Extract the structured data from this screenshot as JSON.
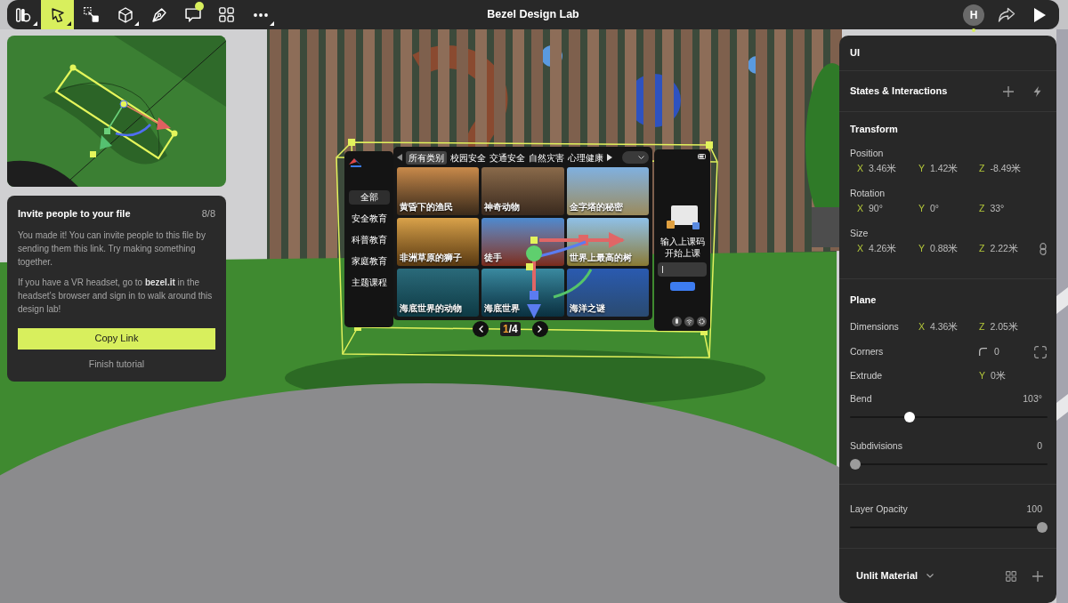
{
  "window": {
    "title": "Bezel Design Lab"
  },
  "toolbar": {
    "tools": [
      {
        "kind": "logo",
        "selected": false,
        "menu": true,
        "badge": false
      },
      {
        "kind": "select",
        "selected": true,
        "menu": true,
        "badge": false
      },
      {
        "kind": "scale",
        "selected": false,
        "menu": false,
        "badge": false
      },
      {
        "kind": "cube",
        "selected": false,
        "menu": true,
        "badge": false
      },
      {
        "kind": "pen",
        "selected": false,
        "menu": false,
        "badge": false
      },
      {
        "kind": "comment",
        "selected": false,
        "menu": false,
        "badge": true
      },
      {
        "kind": "grid",
        "selected": false,
        "menu": false,
        "badge": false
      },
      {
        "kind": "more",
        "selected": false,
        "menu": true,
        "badge": false
      }
    ],
    "avatar": {
      "initial": "H",
      "online": true
    }
  },
  "tutorial": {
    "title": "Invite people to your file",
    "step": "8/8",
    "paragraphs": [
      "You made it! You can invite people to this file by sending them this link. Try making something together.",
      "If you have a VR headset, go to **bezel.it** in the headset’s browser and sign in to walk around this design lab!"
    ],
    "primary_button": "Copy Link",
    "secondary_link": "Finish tutorial"
  },
  "scene_ui": {
    "sidebar": [
      {
        "label": "全部",
        "selected": true
      },
      {
        "label": "安全教育",
        "selected": false
      },
      {
        "label": "科普教育",
        "selected": false
      },
      {
        "label": "家庭教育",
        "selected": false
      },
      {
        "label": "主题课程",
        "selected": false
      }
    ],
    "tabs": [
      {
        "label": "所有类别",
        "selected": true
      },
      {
        "label": "校园安全",
        "selected": false
      },
      {
        "label": "交通安全",
        "selected": false
      },
      {
        "label": "自然灾害",
        "selected": false
      },
      {
        "label": "心理健康",
        "selected": false
      }
    ],
    "cards": [
      {
        "title": "黄昏下的渔民"
      },
      {
        "title": "神奇动物"
      },
      {
        "title": "金字塔的秘密"
      },
      {
        "title": "非洲草原的狮子"
      },
      {
        "title": "徒手"
      },
      {
        "title": "世界上最高的树"
      },
      {
        "title": "海底世界的动物"
      },
      {
        "title": "海底世界"
      },
      {
        "title": "海洋之谜"
      }
    ],
    "page": {
      "current": "1",
      "rest": "/4"
    },
    "join_prompt": "输入上课码开始上课"
  },
  "properties": {
    "title": "UI",
    "interactions": {
      "title": "States & Interactions"
    },
    "transform": {
      "title": "Transform",
      "groups": [
        {
          "label": "Position",
          "kind": "plain",
          "fields": [
            {
              "axis": "X",
              "value": "3.46米"
            },
            {
              "axis": "Y",
              "value": "1.42米"
            },
            {
              "axis": "Z",
              "value": "-8.49米"
            }
          ]
        },
        {
          "label": "Rotation",
          "kind": "plain",
          "fields": [
            {
              "axis": "X",
              "value": "90°"
            },
            {
              "axis": "Y",
              "value": "0°"
            },
            {
              "axis": "Z",
              "value": "33°"
            }
          ]
        },
        {
          "label": "Size",
          "kind": "linkable",
          "fields": [
            {
              "axis": "X",
              "value": "4.26米"
            },
            {
              "axis": "Y",
              "value": "0.88米"
            },
            {
              "axis": "Z",
              "value": "2.22米"
            }
          ]
        }
      ]
    },
    "plane": {
      "title": "Plane",
      "rows": [
        {
          "kind": "axes",
          "label": "Dimensions",
          "fields": [
            {
              "axis": "X",
              "value": "4.36米"
            },
            {
              "axis": "Z",
              "value": "2.05米"
            }
          ]
        },
        {
          "kind": "corners",
          "label": "Corners",
          "value": "0"
        },
        {
          "kind": "axes",
          "label": "Extrude",
          "fields": [
            {
              "axis": "Y",
              "value": "0米"
            }
          ]
        },
        {
          "kind": "slider",
          "label": "Bend",
          "reading": "103°",
          "level": 0.29,
          "focused": true
        },
        {
          "kind": "slider",
          "label": "Subdivisions",
          "reading": "0",
          "level": 0,
          "focused": false
        }
      ]
    },
    "opacity": {
      "label": "Layer Opacity",
      "reading": "100",
      "level": 1,
      "focused": false
    },
    "material": {
      "label": "Unlit Material"
    }
  }
}
